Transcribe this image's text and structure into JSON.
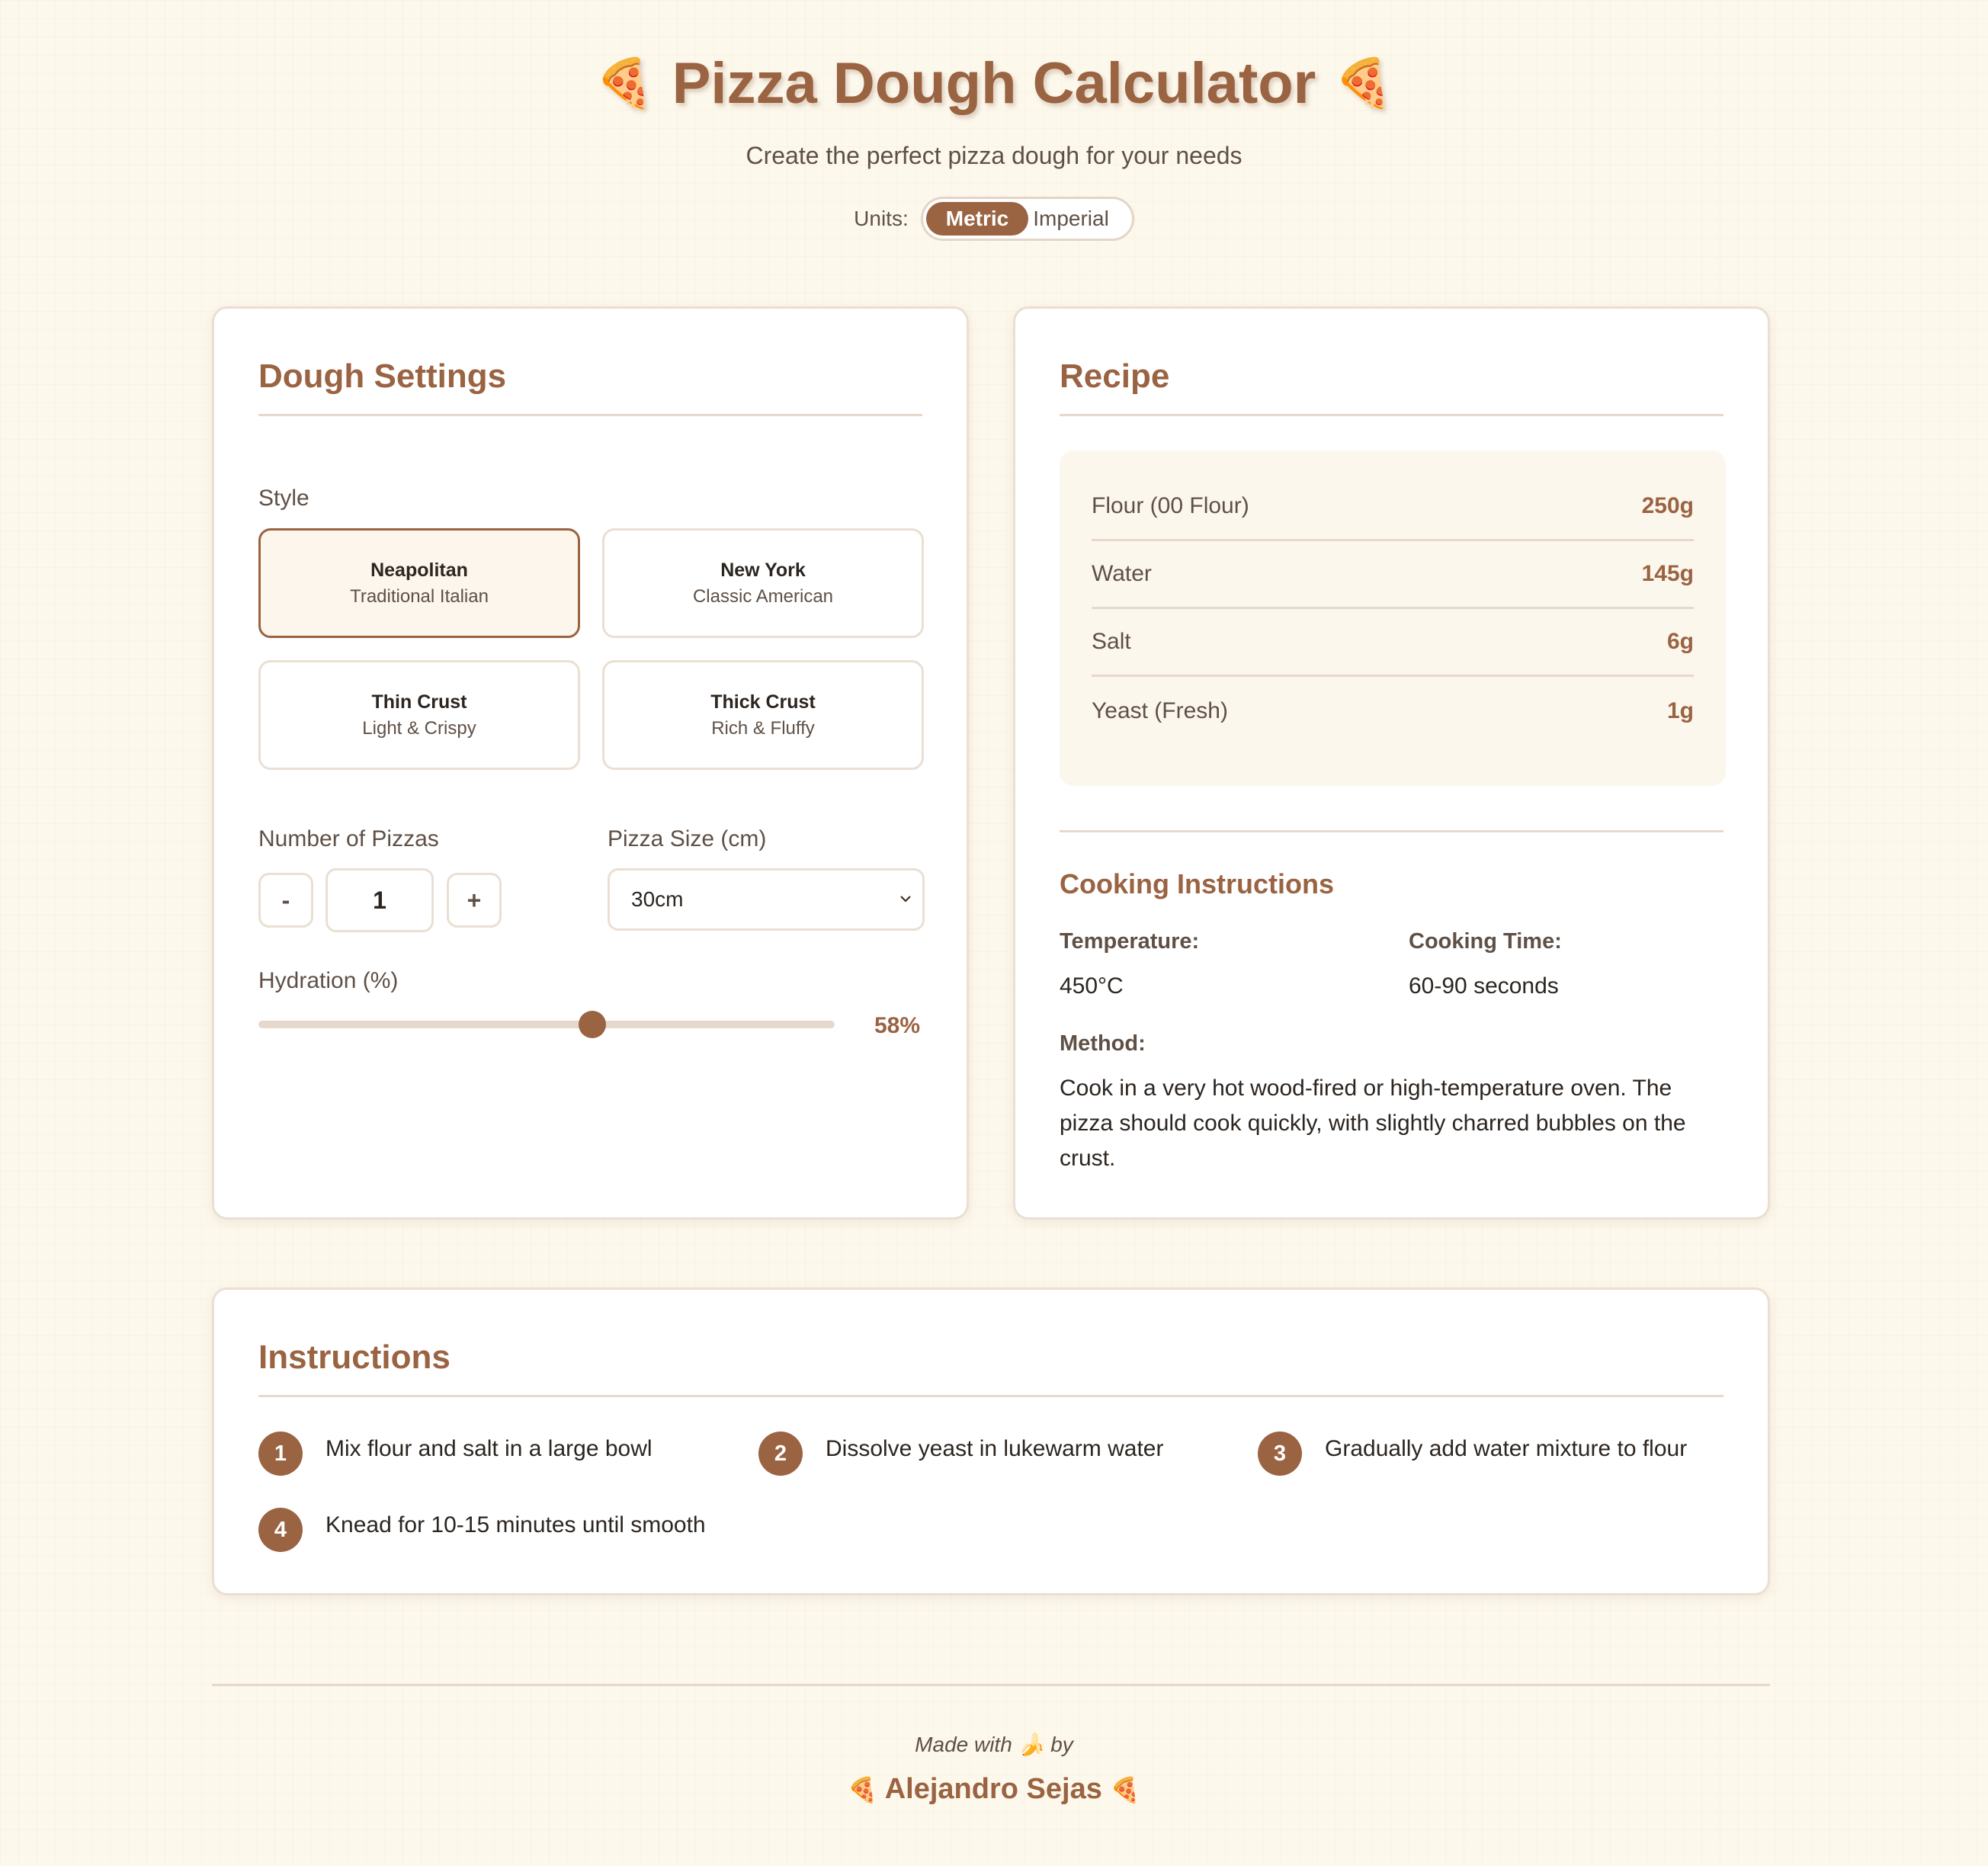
{
  "header": {
    "title": "Pizza Dough Calculator",
    "title_icon": "pizza-icon",
    "subtitle": "Create the perfect pizza dough for your needs",
    "units_label": "Units:",
    "units": [
      "Metric",
      "Imperial"
    ],
    "selected_unit": "Metric"
  },
  "settings": {
    "title": "Dough Settings",
    "style_label": "Style",
    "styles": [
      {
        "name": "Neapolitan",
        "desc": "Traditional Italian",
        "selected": true
      },
      {
        "name": "New York",
        "desc": "Classic American",
        "selected": false
      },
      {
        "name": "Thin Crust",
        "desc": "Light & Crispy",
        "selected": false
      },
      {
        "name": "Thick Crust",
        "desc": "Rich & Fluffy",
        "selected": false
      }
    ],
    "pizzas_label": "Number of Pizzas",
    "decrement": "-",
    "increment": "+",
    "pizzas_value": "1",
    "size_label": "Pizza Size (cm)",
    "size_value": "30cm",
    "hydration_label": "Hydration (%)",
    "hydration_value": "58%",
    "hydration_fraction": 0.58
  },
  "recipe": {
    "title": "Recipe",
    "ingredients": [
      {
        "name": "Flour (00 Flour)",
        "amount": "250g"
      },
      {
        "name": "Water",
        "amount": "145g"
      },
      {
        "name": "Salt",
        "amount": "6g"
      },
      {
        "name": "Yeast (Fresh)",
        "amount": "1g"
      }
    ],
    "cooking_title": "Cooking Instructions",
    "temperature_label": "Temperature:",
    "temperature_value": "450°C",
    "time_label": "Cooking Time:",
    "time_value": "60-90 seconds",
    "method_label": "Method:",
    "method_text": "Cook in a very hot wood-fired or high-temperature oven. The pizza should cook quickly, with slightly charred bubbles on the crust."
  },
  "instructions": {
    "title": "Instructions",
    "steps": [
      {
        "num": "1",
        "text": "Mix flour and salt in a large bowl"
      },
      {
        "num": "2",
        "text": "Dissolve yeast in lukewarm water"
      },
      {
        "num": "3",
        "text": "Gradually add water mixture to flour"
      },
      {
        "num": "4",
        "text": "Knead for 10-15 minutes until smooth"
      }
    ]
  },
  "footer": {
    "made_with": "Made with",
    "made_by": "by",
    "heart_icon": "banana-icon",
    "author": "Alejandro Sejas"
  },
  "colors": {
    "accent": "#9a6342",
    "background": "#fdf8ec",
    "border": "#eadfd2"
  }
}
